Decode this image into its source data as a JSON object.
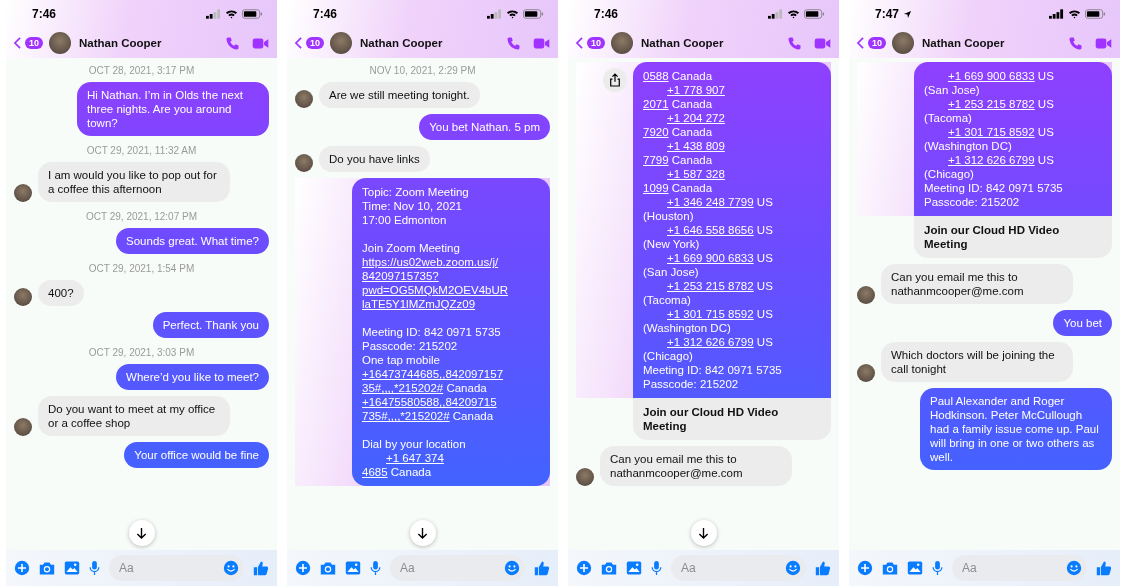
{
  "screens": [
    {
      "status_time": "7:46",
      "location_arrow": false,
      "back_badge": "10",
      "contact_name": "Nathan Cooper",
      "scroll_down_button": true,
      "composer_placeholder": "Aa",
      "messages": [
        {
          "kind": "timestamp",
          "text": "OCT 28, 2021, 3:17 PM"
        },
        {
          "kind": "outgoing",
          "text": "Hi Nathan. I’m in Olds the next three nights. Are you around town?"
        },
        {
          "kind": "timestamp",
          "text": "OCT 29, 2021, 11:32 AM"
        },
        {
          "kind": "incoming",
          "text": "I am would you like to pop out for a coffee this afternoon"
        },
        {
          "kind": "timestamp",
          "text": "OCT 29, 2021, 12:07 PM"
        },
        {
          "kind": "outgoing",
          "text": "Sounds great. What time?"
        },
        {
          "kind": "timestamp",
          "text": "OCT 29, 2021, 1:54 PM"
        },
        {
          "kind": "incoming",
          "text": "400?"
        },
        {
          "kind": "outgoing",
          "text": "Perfect. Thank you"
        },
        {
          "kind": "timestamp",
          "text": "OCT 29, 2021, 3:03 PM"
        },
        {
          "kind": "outgoing",
          "text": "Where’d you like to meet?"
        },
        {
          "kind": "incoming",
          "text": "Do you want to meet at my office or a coffee shop"
        },
        {
          "kind": "outgoing",
          "text": "Your office would be fine"
        }
      ]
    },
    {
      "status_time": "7:46",
      "location_arrow": false,
      "back_badge": "10",
      "contact_name": "Nathan Cooper",
      "scroll_down_button": true,
      "composer_placeholder": "Aa",
      "messages": [
        {
          "kind": "timestamp",
          "text": "NOV 10, 2021, 2:29 PM"
        },
        {
          "kind": "incoming",
          "text": "Are we still meeting tonight."
        },
        {
          "kind": "outgoing",
          "text": "You bet Nathan. 5 pm"
        },
        {
          "kind": "incoming",
          "text": "Do you have links"
        },
        {
          "kind": "outgoing_rich",
          "share_button": false,
          "paragraphs": [
            [
              {
                "indented": false,
                "segments": [
                  {
                    "text": "Topic: Zoom Meeting",
                    "link": false
                  }
                ]
              },
              {
                "indented": false,
                "segments": [
                  {
                    "text": "Time: Nov 10, 2021",
                    "link": false
                  }
                ]
              },
              {
                "indented": false,
                "segments": [
                  {
                    "text": "17:00 Edmonton",
                    "link": false
                  }
                ]
              }
            ],
            [
              {
                "indented": false,
                "segments": [
                  {
                    "text": "Join Zoom Meeting",
                    "link": false
                  }
                ]
              },
              {
                "indented": false,
                "segments": [
                  {
                    "text": "https://us02web.zoom.us/j/",
                    "link": true
                  }
                ]
              },
              {
                "indented": false,
                "segments": [
                  {
                    "text": "84209715735?",
                    "link": true
                  }
                ]
              },
              {
                "indented": false,
                "segments": [
                  {
                    "text": "pwd=OG5MQkM2OEV4bUR",
                    "link": true
                  }
                ]
              },
              {
                "indented": false,
                "segments": [
                  {
                    "text": "laTE5Y1lMZmJQZz09",
                    "link": true
                  }
                ]
              }
            ],
            [
              {
                "indented": false,
                "segments": [
                  {
                    "text": "Meeting ID: 842 0971 5735",
                    "link": false
                  }
                ]
              },
              {
                "indented": false,
                "segments": [
                  {
                    "text": "Passcode: 215202",
                    "link": false
                  }
                ]
              },
              {
                "indented": false,
                "segments": [
                  {
                    "text": "One tap mobile",
                    "link": false
                  }
                ]
              },
              {
                "indented": false,
                "segments": [
                  {
                    "text": "+16473744685,,842097157",
                    "link": true
                  }
                ]
              },
              {
                "indented": false,
                "segments": [
                  {
                    "text": "35#,,,,*215202#",
                    "link": true
                  },
                  {
                    "text": " Canada",
                    "link": false
                  }
                ]
              },
              {
                "indented": false,
                "segments": [
                  {
                    "text": "+16475580588,,84209715",
                    "link": true
                  }
                ]
              },
              {
                "indented": false,
                "segments": [
                  {
                    "text": "735#,,,,*215202#",
                    "link": true
                  },
                  {
                    "text": " Canada",
                    "link": false
                  }
                ]
              }
            ],
            [
              {
                "indented": false,
                "segments": [
                  {
                    "text": "Dial by your location",
                    "link": false
                  }
                ]
              },
              {
                "indented": true,
                "segments": [
                  {
                    "text": "+1 647 374",
                    "link": true
                  }
                ]
              },
              {
                "indented": false,
                "segments": [
                  {
                    "text": "4685",
                    "link": true
                  },
                  {
                    "text": " Canada",
                    "link": false
                  }
                ]
              }
            ]
          ]
        }
      ]
    },
    {
      "status_time": "7:46",
      "location_arrow": false,
      "back_badge": "10",
      "contact_name": "Nathan Cooper",
      "scroll_down_button": true,
      "composer_placeholder": "Aa",
      "messages": [
        {
          "kind": "outgoing_rich",
          "share_button": true,
          "paragraphs": [
            [
              {
                "indented": false,
                "segments": [
                  {
                    "text": "0588",
                    "link": true
                  },
                  {
                    "text": " Canada",
                    "link": false
                  }
                ]
              },
              {
                "indented": true,
                "segments": [
                  {
                    "text": "+1 778 907",
                    "link": true
                  }
                ]
              },
              {
                "indented": false,
                "segments": [
                  {
                    "text": "2071",
                    "link": true
                  },
                  {
                    "text": " Canada",
                    "link": false
                  }
                ]
              },
              {
                "indented": true,
                "segments": [
                  {
                    "text": "+1 204 272",
                    "link": true
                  }
                ]
              },
              {
                "indented": false,
                "segments": [
                  {
                    "text": "7920",
                    "link": true
                  },
                  {
                    "text": " Canada",
                    "link": false
                  }
                ]
              },
              {
                "indented": true,
                "segments": [
                  {
                    "text": "+1 438 809",
                    "link": true
                  }
                ]
              },
              {
                "indented": false,
                "segments": [
                  {
                    "text": "7799",
                    "link": true
                  },
                  {
                    "text": " Canada",
                    "link": false
                  }
                ]
              },
              {
                "indented": true,
                "segments": [
                  {
                    "text": "+1 587 328",
                    "link": true
                  }
                ]
              },
              {
                "indented": false,
                "segments": [
                  {
                    "text": "1099",
                    "link": true
                  },
                  {
                    "text": " Canada",
                    "link": false
                  }
                ]
              },
              {
                "indented": true,
                "segments": [
                  {
                    "text": "+1 346 248 7799",
                    "link": true
                  },
                  {
                    "text": " US",
                    "link": false
                  }
                ]
              },
              {
                "indented": false,
                "segments": [
                  {
                    "text": "(Houston)",
                    "link": false
                  }
                ]
              },
              {
                "indented": true,
                "segments": [
                  {
                    "text": "+1 646 558 8656",
                    "link": true
                  },
                  {
                    "text": " US",
                    "link": false
                  }
                ]
              },
              {
                "indented": false,
                "segments": [
                  {
                    "text": "(New York)",
                    "link": false
                  }
                ]
              },
              {
                "indented": true,
                "segments": [
                  {
                    "text": "+1 669 900 6833",
                    "link": true
                  },
                  {
                    "text": " US",
                    "link": false
                  }
                ]
              },
              {
                "indented": false,
                "segments": [
                  {
                    "text": "(San Jose)",
                    "link": false
                  }
                ]
              },
              {
                "indented": true,
                "segments": [
                  {
                    "text": "+1 253 215 8782",
                    "link": true
                  },
                  {
                    "text": " US",
                    "link": false
                  }
                ]
              },
              {
                "indented": false,
                "segments": [
                  {
                    "text": "(Tacoma)",
                    "link": false
                  }
                ]
              },
              {
                "indented": true,
                "segments": [
                  {
                    "text": "+1 301 715 8592",
                    "link": true
                  },
                  {
                    "text": " US",
                    "link": false
                  }
                ]
              },
              {
                "indented": false,
                "segments": [
                  {
                    "text": "(Washington DC)",
                    "link": false
                  }
                ]
              },
              {
                "indented": true,
                "segments": [
                  {
                    "text": "+1 312 626 6799",
                    "link": true
                  },
                  {
                    "text": " US",
                    "link": false
                  }
                ]
              },
              {
                "indented": false,
                "segments": [
                  {
                    "text": "(Chicago)",
                    "link": false
                  }
                ]
              },
              {
                "indented": false,
                "segments": [
                  {
                    "text": "Meeting ID: 842 0971 5735",
                    "link": false
                  }
                ]
              },
              {
                "indented": false,
                "segments": [
                  {
                    "text": "Passcode: 215202",
                    "link": false
                  }
                ]
              }
            ]
          ]
        },
        {
          "kind": "link_preview",
          "title": "Join our Cloud HD Video Meeting"
        },
        {
          "kind": "incoming",
          "text": "Can you email me this to nathanmcooper@me.com"
        }
      ]
    },
    {
      "status_time": "7:47",
      "location_arrow": true,
      "back_badge": "10",
      "contact_name": "Nathan Cooper",
      "scroll_down_button": false,
      "composer_placeholder": "Aa",
      "messages": [
        {
          "kind": "outgoing_rich",
          "share_button": false,
          "paragraphs": [
            [
              {
                "indented": true,
                "segments": [
                  {
                    "text": "+1 669 900 6833",
                    "link": true
                  },
                  {
                    "text": " US",
                    "link": false
                  }
                ]
              },
              {
                "indented": false,
                "segments": [
                  {
                    "text": "(San Jose)",
                    "link": false
                  }
                ]
              },
              {
                "indented": true,
                "segments": [
                  {
                    "text": "+1 253 215 8782",
                    "link": true
                  },
                  {
                    "text": " US",
                    "link": false
                  }
                ]
              },
              {
                "indented": false,
                "segments": [
                  {
                    "text": "(Tacoma)",
                    "link": false
                  }
                ]
              },
              {
                "indented": true,
                "segments": [
                  {
                    "text": "+1 301 715 8592",
                    "link": true
                  },
                  {
                    "text": " US",
                    "link": false
                  }
                ]
              },
              {
                "indented": false,
                "segments": [
                  {
                    "text": "(Washington DC)",
                    "link": false
                  }
                ]
              },
              {
                "indented": true,
                "segments": [
                  {
                    "text": "+1 312 626 6799",
                    "link": true
                  },
                  {
                    "text": " US",
                    "link": false
                  }
                ]
              },
              {
                "indented": false,
                "segments": [
                  {
                    "text": "(Chicago)",
                    "link": false
                  }
                ]
              },
              {
                "indented": false,
                "segments": [
                  {
                    "text": "Meeting ID: 842 0971 5735",
                    "link": false
                  }
                ]
              },
              {
                "indented": false,
                "segments": [
                  {
                    "text": "Passcode: 215202",
                    "link": false
                  }
                ]
              }
            ]
          ]
        },
        {
          "kind": "link_preview",
          "title": "Join our Cloud HD Video Meeting"
        },
        {
          "kind": "incoming",
          "text": "Can you email me this to nathanmcooper@me.com"
        },
        {
          "kind": "outgoing",
          "text": "You bet"
        },
        {
          "kind": "incoming",
          "text": "Which doctors will be joining the call tonight"
        },
        {
          "kind": "outgoing",
          "text": "Paul Alexander and Roger Hodkinson. Peter McCullough had a family issue come up. Paul will bring in one or two others as well."
        }
      ]
    }
  ]
}
